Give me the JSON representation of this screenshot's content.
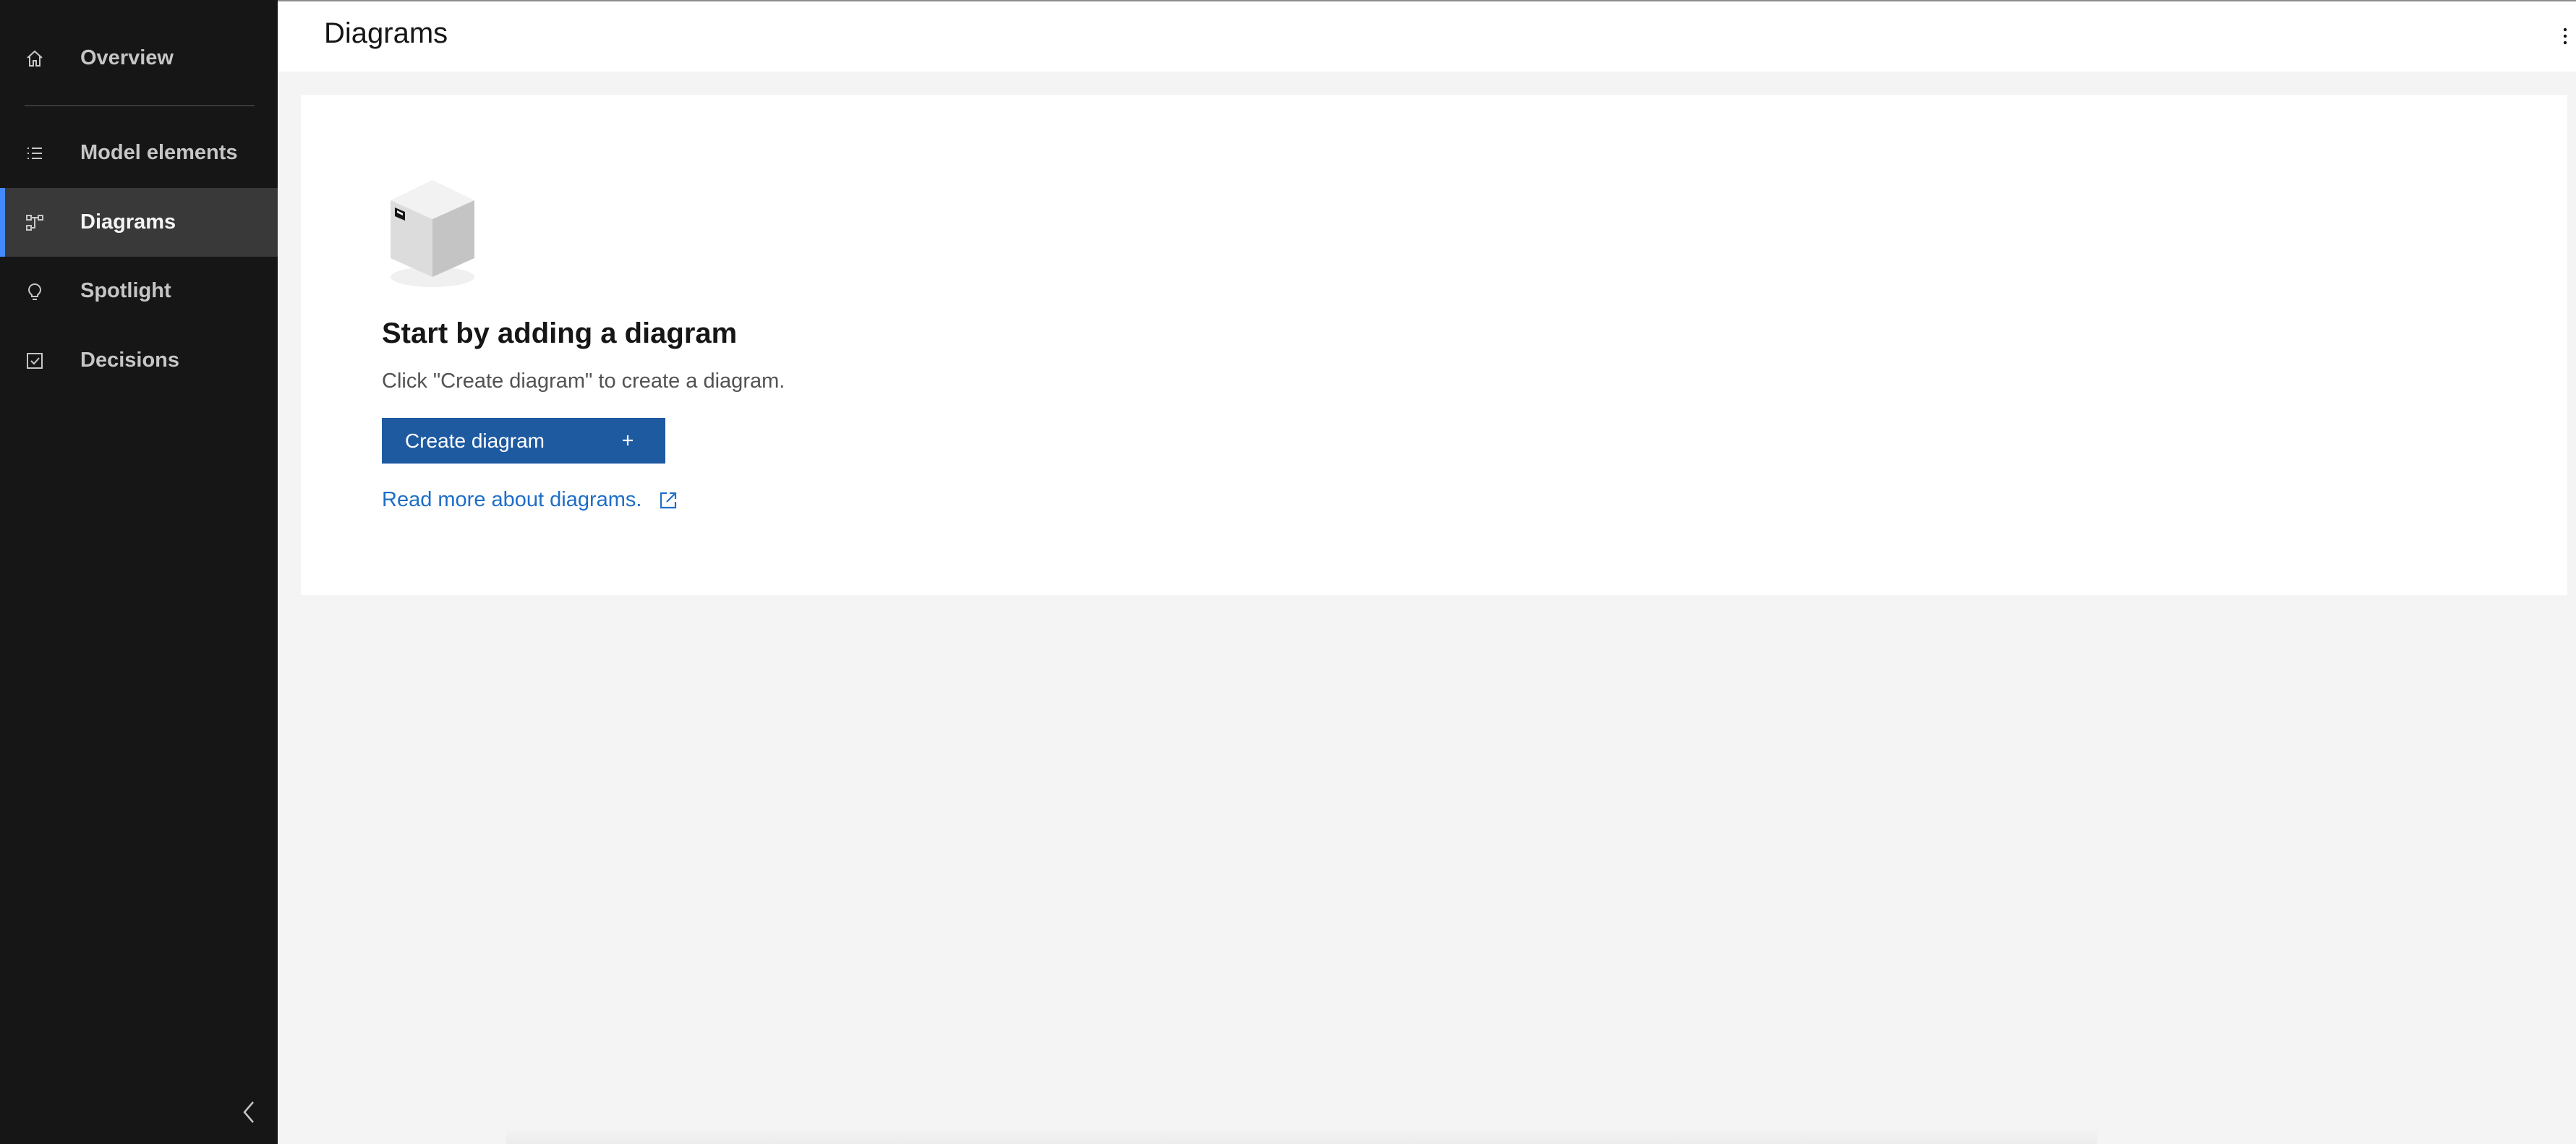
{
  "sidebar": {
    "items": [
      {
        "label": "Overview",
        "icon": "home-icon"
      },
      {
        "label": "Model elements",
        "icon": "list-icon"
      },
      {
        "label": "Diagrams",
        "icon": "diagram-icon",
        "active": true
      },
      {
        "label": "Spotlight",
        "icon": "lightbulb-icon"
      },
      {
        "label": "Decisions",
        "icon": "checkbox-icon"
      }
    ],
    "collapse_icon": "chevron-left-icon"
  },
  "header": {
    "title": "Diagrams",
    "overflow_icon": "overflow-menu-vertical-icon"
  },
  "empty_state": {
    "illustration": "box-illustration",
    "title": "Start by adding a diagram",
    "description": "Click \"Create diagram\" to create a diagram.",
    "create_button_label": "Create diagram",
    "create_button_icon": "add-icon",
    "link_text": "Read more about diagrams.",
    "link_icon": "launch-icon"
  },
  "colors": {
    "sidebar_bg": "#161616",
    "active_item_bg": "#393939",
    "active_indicator": "#4589ff",
    "primary_button": "#1e5aa0",
    "link": "#1e6ec8",
    "page_bg": "#f4f4f4"
  }
}
